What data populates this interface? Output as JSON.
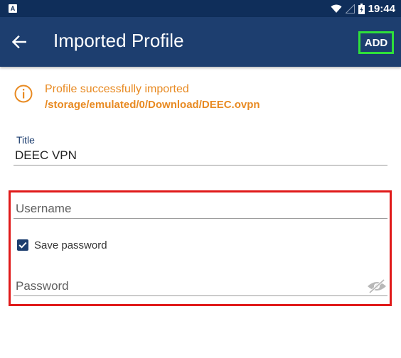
{
  "status_bar": {
    "left_icon_letter": "A",
    "time": "19:44",
    "icons": [
      "wifi-icon",
      "signal-icon",
      "battery-icon"
    ]
  },
  "app_bar": {
    "title": "Imported Profile",
    "back_icon": "arrow-left-icon",
    "action_label": "ADD"
  },
  "notice": {
    "icon": "info-icon",
    "message": "Profile successfully imported",
    "path": "/storage/emulated/0/Download/DEEC.ovpn"
  },
  "form": {
    "title_label": "Title",
    "title_value": "DEEC VPN",
    "username_placeholder": "Username",
    "username_value": "",
    "save_password_label": "Save password",
    "save_password_checked": true,
    "password_placeholder": "Password",
    "password_value": "",
    "password_toggle_icon": "eye-off-icon"
  },
  "colors": {
    "status_bar": "#0f2e5a",
    "app_bar": "#1d3e6f",
    "accent_orange": "#e88a22",
    "add_highlight": "#2fe03a",
    "form_highlight": "#e01a1a"
  }
}
